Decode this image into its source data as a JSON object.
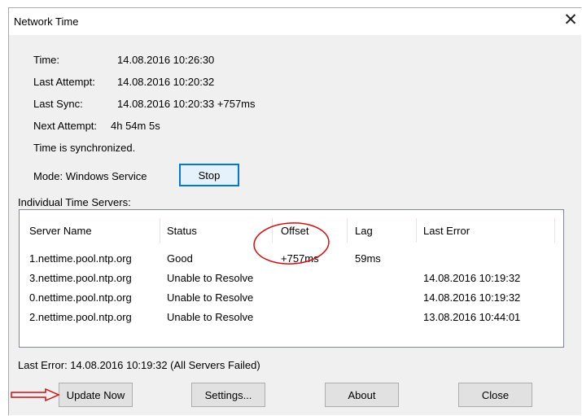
{
  "window": {
    "title": "Network Time",
    "close_glyph": "✕"
  },
  "info": {
    "time_label": "Time:",
    "time_value": "14.08.2016 10:26:30",
    "last_attempt_label": "Last Attempt:",
    "last_attempt_value": "14.08.2016 10:20:32",
    "last_sync_label": "Last Sync:",
    "last_sync_value": "14.08.2016 10:20:33 +757ms",
    "next_attempt_label": "Next Attempt:",
    "next_attempt_value": "4h 54m 5s",
    "sync_status": "Time is synchronized.",
    "mode_text": "Mode: Windows Service",
    "stop_label": "Stop"
  },
  "servers": {
    "group_label": "Individual Time Servers:",
    "columns": [
      "Server Name",
      "Status",
      "Offset",
      "Lag",
      "Last Error"
    ],
    "rows": [
      {
        "name": "1.nettime.pool.ntp.org",
        "status": "Good",
        "offset": "+757ms",
        "lag": "59ms",
        "last_error": ""
      },
      {
        "name": "3.nettime.pool.ntp.org",
        "status": "Unable to Resolve",
        "offset": "",
        "lag": "",
        "last_error": "14.08.2016 10:19:32"
      },
      {
        "name": "0.nettime.pool.ntp.org",
        "status": "Unable to Resolve",
        "offset": "",
        "lag": "",
        "last_error": "14.08.2016 10:19:32"
      },
      {
        "name": "2.nettime.pool.ntp.org",
        "status": "Unable to Resolve",
        "offset": "",
        "lag": "",
        "last_error": "13.08.2016 10:44:01"
      }
    ]
  },
  "footer": {
    "last_error": "Last Error:  14.08.2016 10:19:32 (All Servers Failed)"
  },
  "buttons": {
    "update_now": "Update Now",
    "settings": "Settings...",
    "about": "About",
    "close": "Close"
  },
  "annotations": {
    "color": "#d01010"
  }
}
